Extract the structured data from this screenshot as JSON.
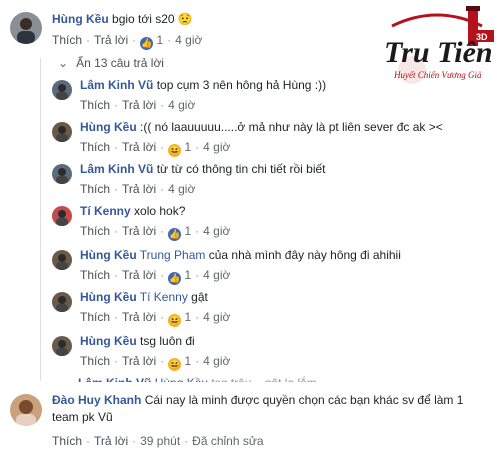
{
  "top_comment": {
    "author": "Hùng Kều",
    "text": "bgio tới s20 😟",
    "like_label": "Thích",
    "reply_label": "Trả lời",
    "reaction_count": "1",
    "time": "4 giờ"
  },
  "hidden_replies_label": "Ẩn 13 câu trả lời",
  "replies": [
    {
      "author": "Lâm Kinh Vũ",
      "mention": "",
      "text": "top cụm 3 nên hông hả Hùng :))",
      "reaction": "",
      "count": "",
      "time": "4 giờ"
    },
    {
      "author": "Hùng Kều",
      "mention": "",
      "text": ":(( nó laauuuuu.....ở mả như này là pt liên sever đc ak ><",
      "reaction": "haha",
      "count": "1",
      "time": "4 giờ"
    },
    {
      "author": "Lâm Kinh Vũ",
      "mention": "",
      "text": "từ từ có thông tin chi tiết rồi biết",
      "reaction": "",
      "count": "",
      "time": "4 giờ"
    },
    {
      "author": "Tí Kenny",
      "mention": "",
      "text": "xolo hok?",
      "reaction": "like",
      "count": "1",
      "time": "4 giờ"
    },
    {
      "author": "Hùng Kều",
      "mention": "Trung Pham",
      "text": "của nhà mình đây này hông đi ahihii",
      "reaction": "like",
      "count": "1",
      "time": "4 giờ"
    },
    {
      "author": "Hùng Kều",
      "mention": "Tí Kenny",
      "text": "gật",
      "reaction": "haha",
      "count": "1",
      "time": "4 giờ"
    },
    {
      "author": "Hùng Kều",
      "mention": "",
      "text": "tsg luôn đi",
      "reaction": "haha",
      "count": "1",
      "time": "4 giờ"
    }
  ],
  "cut_row": {
    "author": "Lâm Kinh Vũ",
    "mention": "Hùng Kều",
    "text": "tsg trâu... gật lạ lắm"
  },
  "reply_labels": {
    "like": "Thích",
    "reply": "Trả lời"
  },
  "bottom_comment": {
    "author": "Đào Huy Khanh",
    "text": "Cái nay là minh được quyền chọn các bạn khác sv để làm 1 team pk Vũ",
    "like_label": "Thích",
    "reply_label": "Trả lời",
    "time": "39 phút",
    "edited": "Đã chỉnh sửa"
  },
  "logo": {
    "main": "Tru Tiên",
    "badge": "3D",
    "tagline": "Huyết Chiến Vương Giả"
  },
  "colors": {
    "link": "#365899",
    "like": "#4267b2",
    "haha": "#f7b125",
    "logo_red": "#b3131b"
  }
}
